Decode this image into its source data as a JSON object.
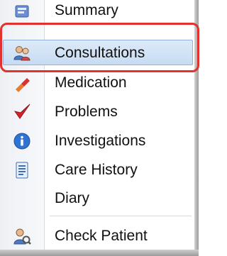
{
  "menu": {
    "items": [
      {
        "label": "Summary",
        "icon": "summary-icon"
      },
      {
        "label": "Consultations",
        "icon": "consultations-icon",
        "selected": true
      },
      {
        "label": "Medication",
        "icon": "medication-icon"
      },
      {
        "label": "Problems",
        "icon": "problems-icon"
      },
      {
        "label": "Investigations",
        "icon": "investigations-icon"
      },
      {
        "label": "Care History",
        "icon": "care-history-icon"
      },
      {
        "label": "Diary",
        "icon": ""
      },
      {
        "label": "Check Patient",
        "icon": "check-patient-icon"
      }
    ]
  },
  "colors": {
    "highlight": "#c7dcf2",
    "annotation": "#e3312f",
    "text": "#111111"
  }
}
